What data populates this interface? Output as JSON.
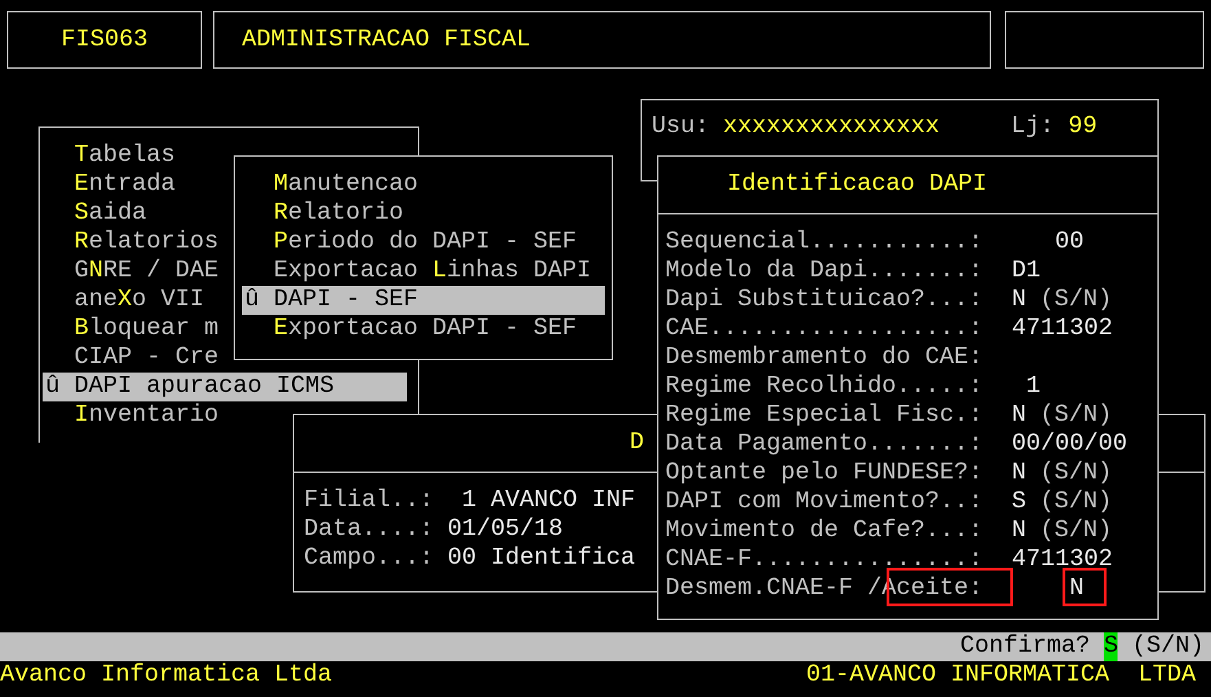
{
  "header": {
    "code": "FIS063",
    "title": "ADMINISTRACAO FISCAL"
  },
  "user_panel": {
    "user_label": "Usu:",
    "user": "xxxxxxxxxxxxxxx",
    "store_label": "Lj:",
    "store": "99"
  },
  "main_menu": [
    {
      "label": "**T**abelas",
      "selected": false
    },
    {
      "label": "**E**ntrada",
      "selected": false
    },
    {
      "label": "**S**aida",
      "selected": false
    },
    {
      "label": "**R**elatorios",
      "selected": false
    },
    {
      "label": "G**N**RE / DAE",
      "selected": false
    },
    {
      "label": "ane**X**o VII",
      "selected": false
    },
    {
      "label": "**B**loquear m",
      "selected": false
    },
    {
      "label": "CIAP - Cre",
      "selected": false
    },
    {
      "label": "û DAPI apuracao ICMS",
      "selected": true
    },
    {
      "label": "**I**nventario",
      "selected": false
    }
  ],
  "submenu": [
    {
      "label": "**M**anutencao",
      "selected": false
    },
    {
      "label": "**R**elatorio",
      "selected": false
    },
    {
      "label": "**P**eriodo do DAPI - SEF",
      "selected": false
    },
    {
      "label": "Exportacao **L**inhas DAPI",
      "selected": false
    },
    {
      "label": "û DAPI - SEF",
      "selected": true
    },
    {
      "label": "**E**xportacao DAPI - SEF",
      "selected": false
    }
  ],
  "back_panel": {
    "title": "D",
    "rows": [
      {
        "label": "Filial..:",
        "value": " 1 AVANCO INF"
      },
      {
        "label": "Data....:",
        "value": "01/05/18"
      },
      {
        "label": "Campo...:",
        "value": "00 Identifica"
      }
    ]
  },
  "dialog": {
    "title": "Identificacao DAPI",
    "fields": [
      {
        "label": "Sequencial...........:",
        "value": "   00"
      },
      {
        "label": "Modelo da Dapi.......:",
        "value": "D1"
      },
      {
        "label": "Dapi Substituicao?...:",
        "value": "N",
        "hint": "(S/N)"
      },
      {
        "label": "CAE..................:",
        "value": "4711302"
      },
      {
        "label": "Desmembramento do CAE:"
      },
      {
        "label": "Regime Recolhido.....:",
        "value": " 1"
      },
      {
        "label": "Regime Especial Fisc.:",
        "value": "N",
        "hint": "(S/N)"
      },
      {
        "label": "Data Pagamento.......:",
        "value": "00/00/00"
      },
      {
        "label": "Optante pelo FUNDESE?:",
        "value": "N",
        "hint": "(S/N)"
      },
      {
        "label": "DAPI com Movimento?..:",
        "value": "S",
        "hint": "(S/N)"
      },
      {
        "label": "Movimento de Cafe?...:",
        "value": "N",
        "hint": "(S/N)"
      },
      {
        "label": "CNAE-F...............:",
        "value": "4711302"
      },
      {
        "label": "Desmem.CNAE-F /Aceite:",
        "value": "    N",
        "highlighted": true
      }
    ]
  },
  "status_bar": {
    "prompt": "Confirma?",
    "answer": "S",
    "hint": "(S/N)"
  },
  "footer": {
    "company": "Avanco Informatica Ltda",
    "branch": "01-AVANCO INFORMATICA  LTDA"
  }
}
